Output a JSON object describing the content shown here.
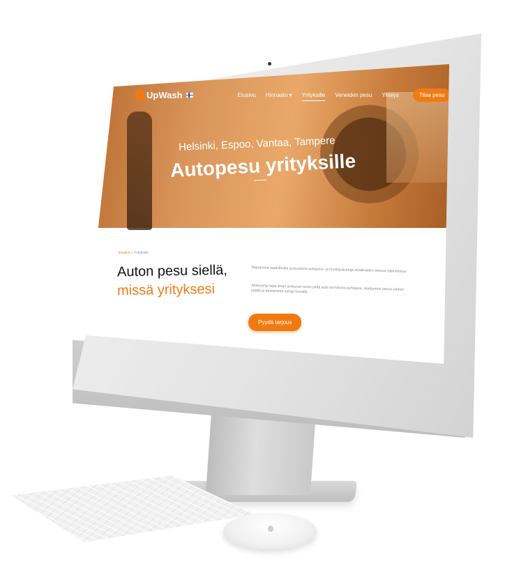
{
  "logo": {
    "text": "UpWash"
  },
  "nav": {
    "items": [
      {
        "label": "Etusivu",
        "active": false
      },
      {
        "label": "Hinnasto",
        "active": false,
        "has_dropdown": true
      },
      {
        "label": "Yrityksille",
        "active": true
      },
      {
        "label": "Veneiden pesu",
        "active": false
      },
      {
        "label": "Yhteys",
        "active": false
      }
    ],
    "cta_label": "Tilaa pesu"
  },
  "hero": {
    "subtitle": "Helsinki, Espoo, Vantaa, Tampere",
    "title": "Autopesu yrityksille"
  },
  "breadcrumb": {
    "home": "Etusivu",
    "separator": "»",
    "current": "Yrityksille"
  },
  "section": {
    "heading_line1": "Auton pesu siellä,",
    "heading_line2": "missä yrityksesi",
    "paragraph1": "Tarjoamme laadukkaita ja joustavia autopesu- ja huoltopalveluja asiakkaiden omissa sijainneissa.",
    "paragraph2": "Ahkerempi tapa ilman jonkuvan tavan pitää auto tai kalusto puhtaana. Hoidamme pesun paikan päällä ja peseemme sunge kerralla.",
    "cta_label": "Pyydä tarjous"
  },
  "colors": {
    "accent": "#f07a12",
    "heading": "#111111",
    "muted_text": "#888888"
  },
  "icons": [
    "logo-mark-icon",
    "finland-flag-icon",
    "chevron-down-icon",
    "camera-dot",
    "apple-logo-icon"
  ]
}
